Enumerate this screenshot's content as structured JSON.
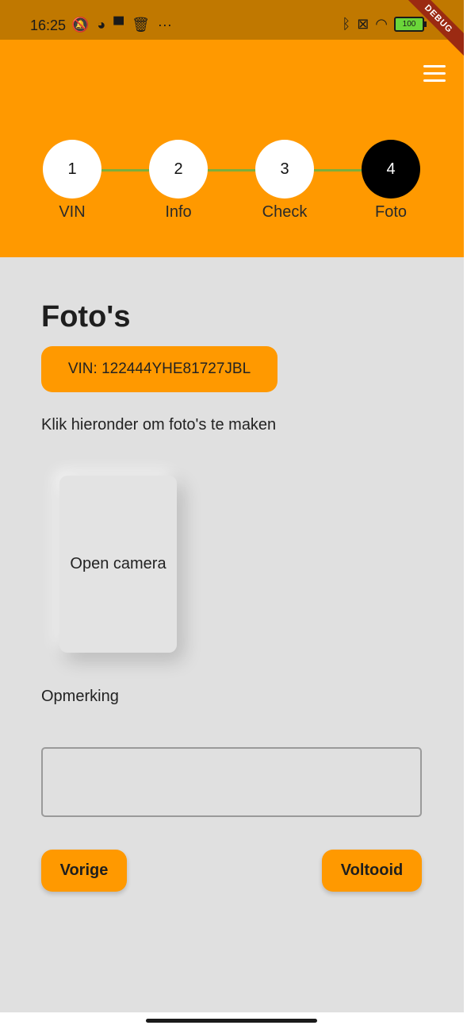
{
  "status_bar": {
    "time": "16:25",
    "more_indicator": "···",
    "battery_level": "100",
    "debug_label": "DEBUG"
  },
  "colors": {
    "accent": "#ff9900",
    "status_bar": "#c07800",
    "background": "#e0e0e0",
    "step_connector": "#7cae3c",
    "active_step": "#000000"
  },
  "stepper": {
    "steps": [
      {
        "number": "1",
        "label": "VIN"
      },
      {
        "number": "2",
        "label": "Info"
      },
      {
        "number": "3",
        "label": "Check"
      },
      {
        "number": "4",
        "label": "Foto"
      }
    ],
    "active_index": 3
  },
  "content": {
    "title": "Foto's",
    "vin_chip": "VIN: 122444YHE81727JBL",
    "instruction": "Klik hieronder om foto's te maken",
    "camera_button": "Open camera",
    "remark_label": "Opmerking",
    "remark_value": ""
  },
  "actions": {
    "previous": "Vorige",
    "complete": "Voltooid"
  }
}
